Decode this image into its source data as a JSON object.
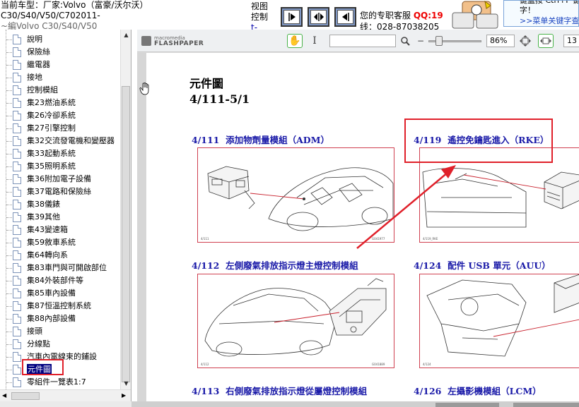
{
  "header": {
    "car_line1": "当前车型：厂家:Volvo（富豪/沃尔沃）",
    "car_line2": "C30/S40/V50/C702011-",
    "car_line3": "~編Volvo  C30/S40/V50",
    "view_line1": "视图",
    "view_line2": "控制",
    "view_line3": "t-",
    "support_label": "您的专职客服",
    "support_qq": "QQ:19",
    "support_phone": "线：028-87038205",
    "tip_line1": "键盘按  Ctrl+F  键",
    "tip_line2": "字！",
    "tip_link": ">>菜单关键字查"
  },
  "nav_buttons": [
    {
      "name": "next-page-button",
      "glyph": "▶"
    },
    {
      "name": "fit-page-button",
      "glyph": "◀▶"
    },
    {
      "name": "prev-page-button",
      "glyph": "◀"
    }
  ],
  "tree": {
    "items": [
      "說明",
      "保險絲",
      "繼電器",
      "接地",
      "控制模組",
      "集23燃油系統",
      "集26冷卻系統",
      "集27引擎控制",
      "集32交流發電機和變壓器",
      "集33起動系統",
      "集35照明系統",
      "集36附加電子設備",
      "集37電路和保險絲",
      "集38儀錶",
      "集39其他",
      "集43變速箱",
      "集59敘車系統",
      "集64轉向系",
      "集83車門與可開啟部位",
      "集84外裝部件等",
      "集85車內設備",
      "集87恒溫控制系統",
      "集88內部設備",
      "接頭",
      "分線點",
      "汽車內電線束的鋪設",
      "元件圖",
      "零組件一覽表1:7"
    ],
    "selected_index": 26
  },
  "viewer": {
    "logo_line1": "macromedia",
    "logo_line2": "FLASHPAPER",
    "search_value": "",
    "zoom": "86%",
    "page_number": "13"
  },
  "document": {
    "title": "元件圖",
    "subtitle": "4/111-5/1",
    "sections": [
      {
        "code": "4/111",
        "label": "添加物劑量模組（ADM）"
      },
      {
        "code": "4/119",
        "label": "遙控免鑰匙進入（RKE）"
      },
      {
        "code": "4/112",
        "label": "左側廢氣排放指示燈主燈控制模組"
      },
      {
        "code": "4/124",
        "label": "配件 USB 單元（AUU）"
      },
      {
        "code": "4/113",
        "label": "右側廢氣排放指示燈從屬燈控制模組"
      },
      {
        "code": "4/126",
        "label": "左攝影機模組（LCM）"
      }
    ],
    "figure_tags": [
      "4/111",
      "G041977",
      "4/119_RKE",
      "4/112",
      "G041889",
      "4/124"
    ]
  },
  "colors": {
    "section_blue": "#1a1aa8",
    "highlight_red": "#e0202a",
    "selected_bg": "#000080"
  }
}
